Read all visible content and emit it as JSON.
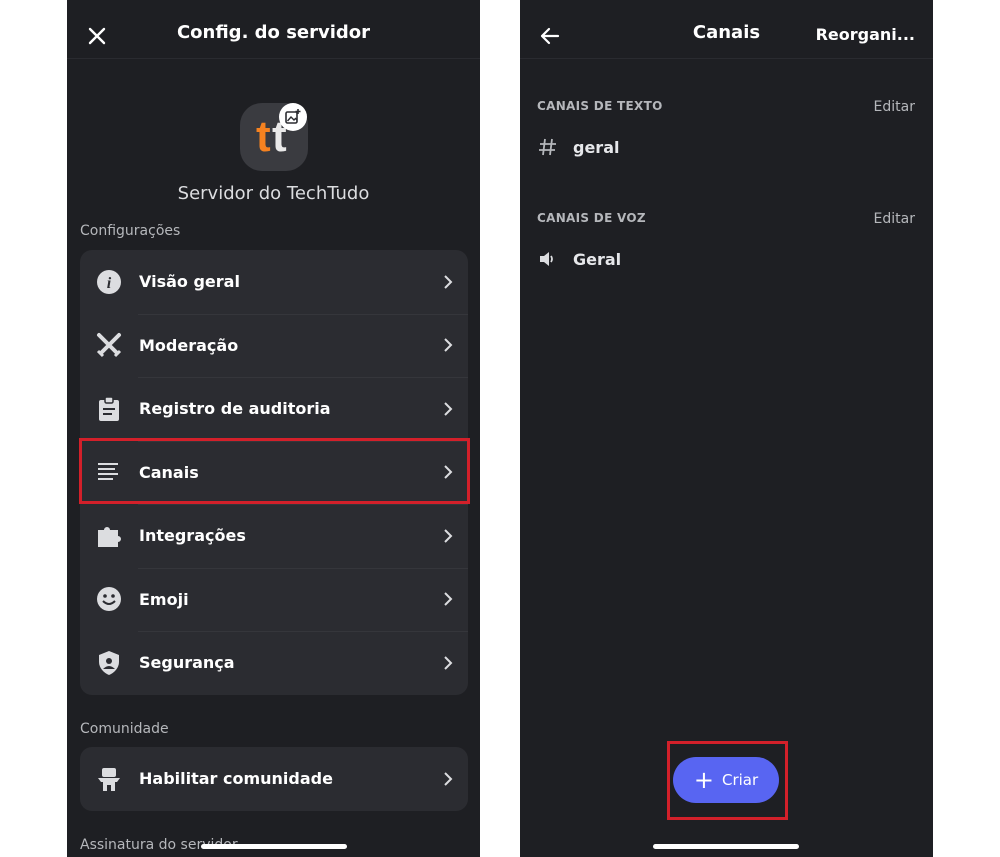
{
  "left_screen": {
    "header_title": "Config. do servidor",
    "server_name": "Servidor do TechTudo",
    "server_logo_text": [
      "t",
      "t"
    ],
    "sections": [
      {
        "label": "Configurações",
        "items": [
          {
            "label": "Visão geral",
            "icon": "info-icon"
          },
          {
            "label": "Moderação",
            "icon": "swords-icon"
          },
          {
            "label": "Registro de auditoria",
            "icon": "clipboard-icon"
          },
          {
            "label": "Canais",
            "icon": "channels-list-icon"
          },
          {
            "label": "Integrações",
            "icon": "puzzle-icon"
          },
          {
            "label": "Emoji",
            "icon": "smiley-icon"
          },
          {
            "label": "Segurança",
            "icon": "shield-icon"
          }
        ]
      },
      {
        "label": "Comunidade",
        "items": [
          {
            "label": "Habilitar comunidade",
            "icon": "community-icon"
          }
        ]
      },
      {
        "label": "Assinatura do servidor",
        "items": []
      }
    ],
    "highlighted_item": "Canais"
  },
  "right_screen": {
    "header_title": "Canais",
    "reorder_label": "Reorgani...",
    "categories": [
      {
        "title": "CANAIS DE TEXTO",
        "edit_label": "Editar",
        "channels": [
          {
            "name": "geral",
            "icon": "hash-icon"
          }
        ]
      },
      {
        "title": "CANAIS DE VOZ",
        "edit_label": "Editar",
        "channels": [
          {
            "name": "Geral",
            "icon": "speaker-icon"
          }
        ]
      }
    ],
    "create_button_label": "Criar"
  },
  "colors": {
    "background": "#1e1f23",
    "card": "#2b2c31",
    "highlight": "#d3202a",
    "accent": "#5865f2",
    "logo_orange": "#f58220"
  }
}
